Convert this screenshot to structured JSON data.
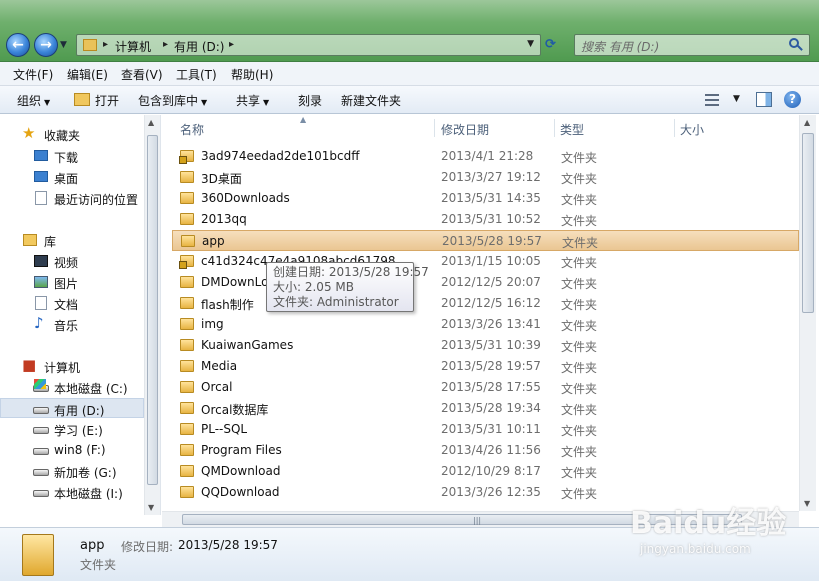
{
  "address": {
    "breadcrumb": [
      "计算机",
      "有用 (D:)"
    ],
    "search_placeholder": "搜索 有用 (D:)"
  },
  "menubar": {
    "items": [
      "文件(F)",
      "编辑(E)",
      "查看(V)",
      "工具(T)",
      "帮助(H)"
    ]
  },
  "toolbar": {
    "organize": "组织",
    "open": "打开",
    "include_in_library": "包含到库中",
    "share": "共享",
    "burn": "刻录",
    "new_folder": "新建文件夹"
  },
  "navpane": {
    "favorites": "收藏夹",
    "favorites_items": [
      "下载",
      "桌面",
      "最近访问的位置"
    ],
    "libraries": "库",
    "library_items": [
      "视频",
      "图片",
      "文档",
      "音乐"
    ],
    "computer": "计算机",
    "drives": [
      "本地磁盘 (C:)",
      "有用 (D:)",
      "学习 (E:)",
      "win8 (F:)",
      "新加卷 (G:)",
      "本地磁盘 (I:)"
    ],
    "selected_drive": "有用 (D:)"
  },
  "columns": {
    "name": "名称",
    "date": "修改日期",
    "type": "类型",
    "size": "大小"
  },
  "files": [
    {
      "name": "3ad974eedad2de101bcdff",
      "date": "2013/4/1 21:28",
      "type": "文件夹",
      "locked": true
    },
    {
      "name": "3D桌面",
      "date": "2013/3/27 19:12",
      "type": "文件夹",
      "locked": false
    },
    {
      "name": "360Downloads",
      "date": "2013/5/31 14:35",
      "type": "文件夹",
      "locked": false
    },
    {
      "name": "2013qq",
      "date": "2013/5/31 10:52",
      "type": "文件夹",
      "locked": false
    },
    {
      "name": "app",
      "date": "2013/5/28 19:57",
      "type": "文件夹",
      "locked": false,
      "selected": true
    },
    {
      "name": "c41d324c47e4a9108abcd61798",
      "date": "2013/1/15 10:05",
      "type": "文件夹",
      "locked": true
    },
    {
      "name": "DMDownLoad",
      "date": "2012/12/5 20:07",
      "type": "文件夹",
      "locked": false
    },
    {
      "name": "flash制作",
      "date": "2012/12/5 16:12",
      "type": "文件夹",
      "locked": false
    },
    {
      "name": "img",
      "date": "2013/3/26 13:41",
      "type": "文件夹",
      "locked": false
    },
    {
      "name": "KuaiwanGames",
      "date": "2013/5/31 10:39",
      "type": "文件夹",
      "locked": false
    },
    {
      "name": "Media",
      "date": "2013/5/28 19:57",
      "type": "文件夹",
      "locked": false
    },
    {
      "name": "Orcal",
      "date": "2013/5/28 17:55",
      "type": "文件夹",
      "locked": false
    },
    {
      "name": "Orcal数据库",
      "date": "2013/5/28 19:34",
      "type": "文件夹",
      "locked": false
    },
    {
      "name": "PL--SQL",
      "date": "2013/5/31 10:11",
      "type": "文件夹",
      "locked": false
    },
    {
      "name": "Program Files",
      "date": "2013/4/26 11:56",
      "type": "文件夹",
      "locked": false
    },
    {
      "name": "QMDownload",
      "date": "2012/10/29 8:17",
      "type": "文件夹",
      "locked": false
    },
    {
      "name": "QQDownload",
      "date": "2013/3/26 12:35",
      "type": "文件夹",
      "locked": false
    }
  ],
  "tooltip": {
    "created": "创建日期: 2013/5/28 19:57",
    "size": "大小: 2.05 MB",
    "folder": "文件夹: Administrator"
  },
  "details": {
    "name": "app",
    "modified_label": "修改日期:",
    "modified_value": "2013/5/28 19:57",
    "type": "文件夹"
  },
  "watermark": {
    "text": "Baidu经验",
    "sub": "jingyan.baidu.com"
  }
}
